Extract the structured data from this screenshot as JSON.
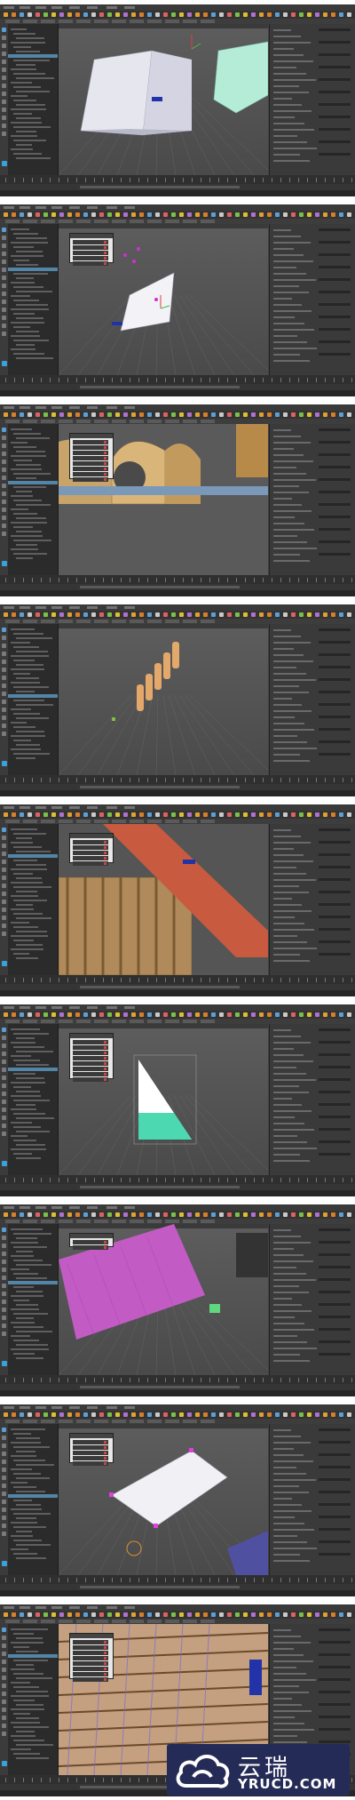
{
  "app": {
    "name": "Maya",
    "step_count": 9
  },
  "steps": [
    {
      "scene": "roof-blockout",
      "popup": false
    },
    {
      "scene": "single-plane-with-locators",
      "popup": true
    },
    {
      "scene": "curved-tile-closeup",
      "popup": true
    },
    {
      "scene": "tile-column-layout",
      "popup": false
    },
    {
      "scene": "tiled-roof-closeup",
      "popup": true
    },
    {
      "scene": "triangle-plane-selected",
      "popup": true
    },
    {
      "scene": "magenta-tile-array",
      "popup": true
    },
    {
      "scene": "plane-with-control-points",
      "popup": true
    },
    {
      "scene": "finished-roof-tiles",
      "popup": true
    }
  ],
  "watermark": {
    "text_cn": "云瑞",
    "text_en": "YRUCD.COM",
    "colors": {
      "background": "#252b57",
      "text": "#ffffff"
    }
  }
}
